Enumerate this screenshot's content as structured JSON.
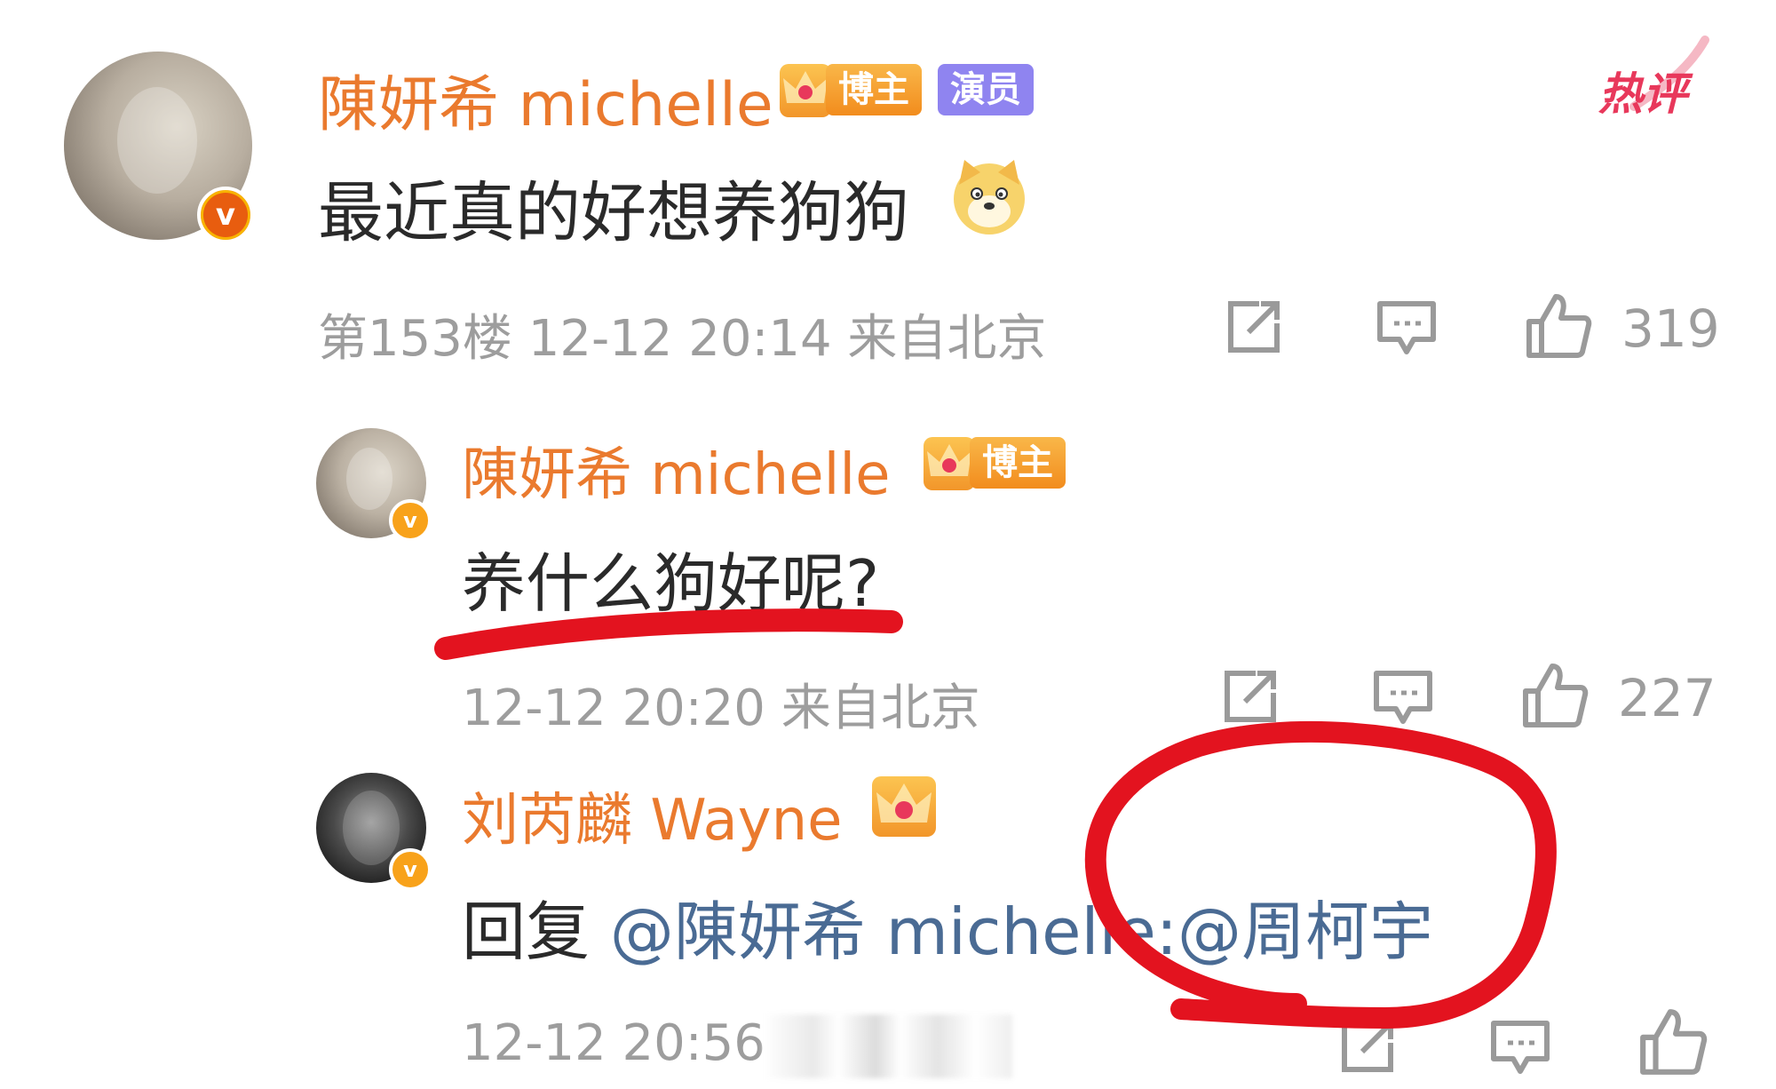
{
  "comments": [
    {
      "username": "陳妍希 michelle",
      "badges": [
        "博主",
        "演员"
      ],
      "hot_label": "热评",
      "content": "最近真的好想养狗狗",
      "emoji": "dog-emoji",
      "meta": "第153楼 12-12 20:14 来自北京",
      "likes": "319"
    },
    {
      "username": "陳妍希 michelle",
      "badges": [
        "博主"
      ],
      "content": "养什么狗好呢?",
      "meta": "12-12 20:20 来自北京",
      "likes": "227"
    },
    {
      "username": "刘芮麟 Wayne",
      "content_prefix": "回复",
      "mention_1": "@陳妍希 michelle:",
      "mention_2": "@周柯宇",
      "meta": "12-12 20:56",
      "likes": ""
    }
  ],
  "colors": {
    "username": "#ea7a2e",
    "mention": "#4a6b94",
    "meta": "#9d9d9d",
    "annotation": "#e3131f",
    "actor_tag": "#8f84f0",
    "hot": "#e8385b"
  },
  "icons": [
    "share-icon",
    "comment-icon",
    "like-icon",
    "crown-icon",
    "verified-icon"
  ]
}
